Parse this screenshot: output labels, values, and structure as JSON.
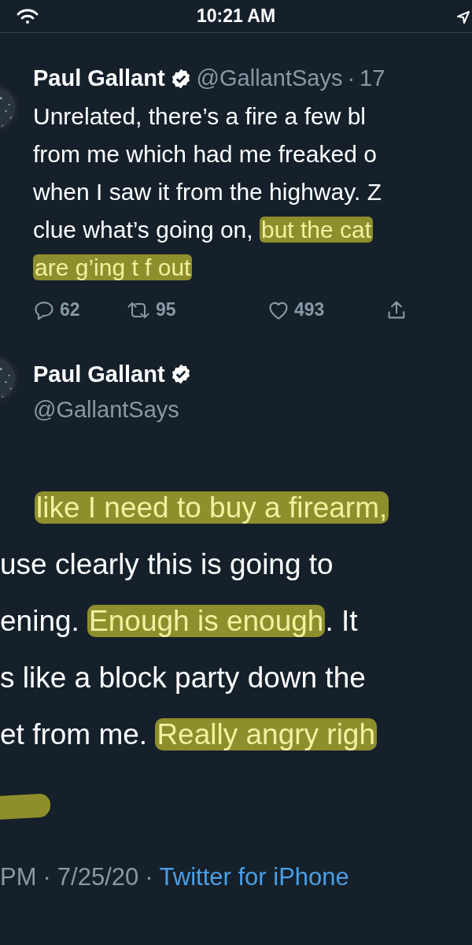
{
  "status_bar": {
    "time": "10:21 AM"
  },
  "reply_tweet": {
    "name": "Paul Gallant",
    "verified": true,
    "handle": "@GallantSays",
    "separator": "·",
    "time": "17",
    "lines": [
      [
        {
          "text": "Unrelated, there’s a fire a few bl",
          "highlighted": false
        }
      ],
      [
        {
          "text": "from me which had me freaked o",
          "highlighted": false
        }
      ],
      [
        {
          "text": "when I saw it from the highway. Z",
          "highlighted": false
        }
      ],
      [
        {
          "text": "clue what’s going on, ",
          "highlighted": false
        },
        {
          "text": "but the cat",
          "highlighted": true
        }
      ],
      [
        {
          "text": "are g’ing t f out",
          "highlighted": true
        }
      ]
    ],
    "actions": [
      {
        "kind": "reply",
        "count": "62"
      },
      {
        "kind": "retweet",
        "count": "95"
      },
      {
        "kind": "like",
        "count": "493"
      },
      {
        "kind": "share"
      }
    ]
  },
  "main_tweet": {
    "name": "Paul Gallant",
    "verified": true,
    "handle": "@GallantSays",
    "lines": [
      [
        {
          "text": "like I need to buy a firearm,",
          "highlighted": true
        }
      ],
      [
        {
          "text": "use clearly this is going to",
          "highlighted": false
        }
      ],
      [
        {
          "text": "ening. ",
          "highlighted": false
        },
        {
          "text": "Enough is enough",
          "highlighted": true
        },
        {
          "text": ". It",
          "highlighted": false
        }
      ],
      [
        {
          "text": "s like a block party down the",
          "highlighted": false
        }
      ],
      [
        {
          "text": "et from me. ",
          "highlighted": false
        },
        {
          "text": "Really angry righ",
          "highlighted": true
        }
      ]
    ],
    "footer": [
      {
        "kind": "text",
        "text": "PM"
      },
      {
        "kind": "text",
        "text": "·"
      },
      {
        "kind": "text",
        "text": "7/25/20"
      },
      {
        "kind": "text",
        "text": "·"
      },
      {
        "kind": "link",
        "text": "Twitter for iPhone"
      }
    ]
  }
}
